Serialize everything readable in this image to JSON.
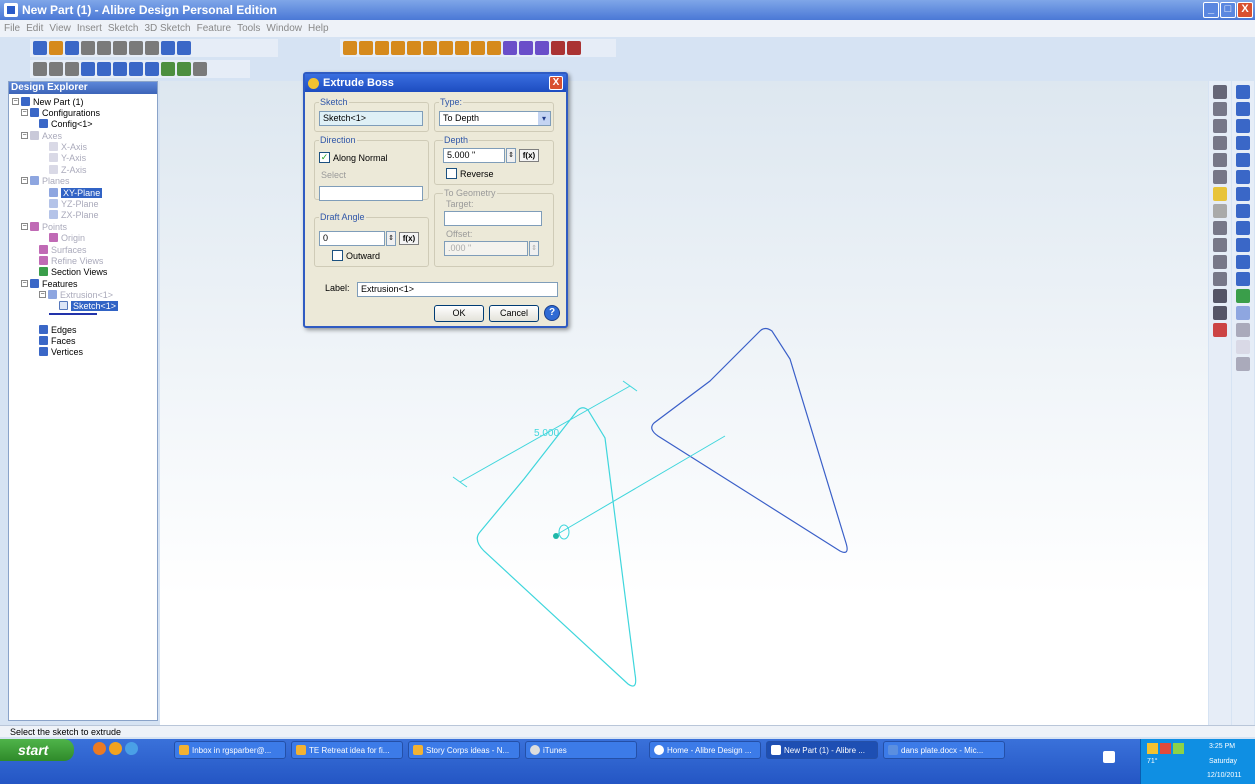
{
  "window": {
    "title": "New Part (1) - Alibre Design Personal Edition"
  },
  "menu": [
    "File",
    "Edit",
    "View",
    "Insert",
    "Sketch",
    "3D Sketch",
    "Feature",
    "Tools",
    "Window",
    "Help"
  ],
  "explorer": {
    "title": "Design Explorer",
    "nodes": {
      "root": "New Part (1)",
      "configurations": "Configurations",
      "config1": "Config<1>",
      "axes": "Axes",
      "xaxis": "X-Axis",
      "yaxis": "Y-Axis",
      "zaxis": "Z-Axis",
      "planes": "Planes",
      "xyplane": "XY-Plane",
      "yzplane": "YZ-Plane",
      "zxplane": "ZX-Plane",
      "points": "Points",
      "origin": "Origin",
      "surfaces": "Surfaces",
      "refine": "Refine Views",
      "section": "Section Views",
      "features": "Features",
      "extrusion": "Extrusion<1>",
      "sketch": "Sketch<1>",
      "edges": "Edges",
      "faces": "Faces",
      "vertices": "Vertices"
    }
  },
  "status": "Select the sketch to extrude",
  "dialog": {
    "title": "Extrude Boss",
    "sketch_label": "Sketch",
    "sketch_value": "Sketch<1>",
    "type_label": "Type:",
    "type_value": "To Depth",
    "direction_label": "Direction",
    "along_normal": "Along Normal",
    "select_label": "Select",
    "depth_label": "Depth",
    "depth_value": "5.000 \"",
    "fx": "f(x)",
    "reverse": "Reverse",
    "to_geometry": "To Geometry",
    "target_label": "Target:",
    "offset_label": "Offset:",
    "offset_value": ".000 \"",
    "draft_label": "Draft Angle",
    "draft_value": "0",
    "outward": "Outward",
    "label_label": "Label:",
    "label_value": "Extrusion<1>",
    "ok": "OK",
    "cancel": "Cancel"
  },
  "viewport": {
    "dimension": "5.000"
  },
  "taskbar": {
    "start": "start",
    "items": [
      "Inbox in rgsparber@...",
      "TE Retreat idea for fi...",
      "Story Corps ideas - N...",
      "iTunes",
      "Home - Alibre Design ...",
      "New Part (1) - Alibre ...",
      "dans plate.docx - Mic..."
    ],
    "time": "3:25 PM",
    "day": "Saturday",
    "date": "12/10/2011",
    "temp": "71°"
  },
  "colors": {
    "sketch": "#3fd6dc",
    "extrude": "#3a5fc8",
    "titlebar": "#3a6fe0"
  }
}
